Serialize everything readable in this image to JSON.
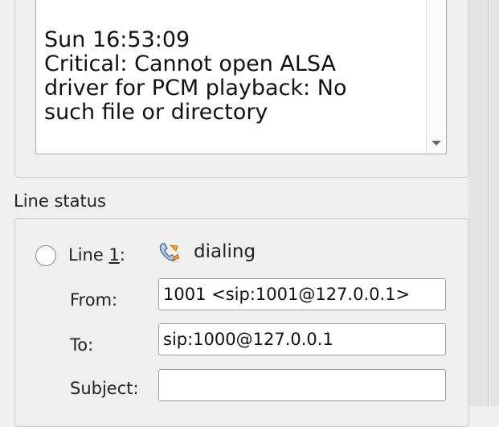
{
  "display": {
    "lines": [
      "Sun 16:53:09",
      "Critical: Cannot open ALSA",
      "driver for PCM playback: No",
      "such file or directory"
    ]
  },
  "line_status": {
    "title": "Line status",
    "line_label_prefix": "Line ",
    "line_number": "1",
    "line_label_suffix": ":",
    "status_icon": "dialing-phone-icon",
    "status_text": "dialing",
    "from_label": "From:",
    "from_value": "1001 <sip:1001@127.0.0.1>",
    "to_label": "To:",
    "to_value": "sip:1000@127.0.0.1",
    "subject_label": "Subject:",
    "subject_value": ""
  }
}
